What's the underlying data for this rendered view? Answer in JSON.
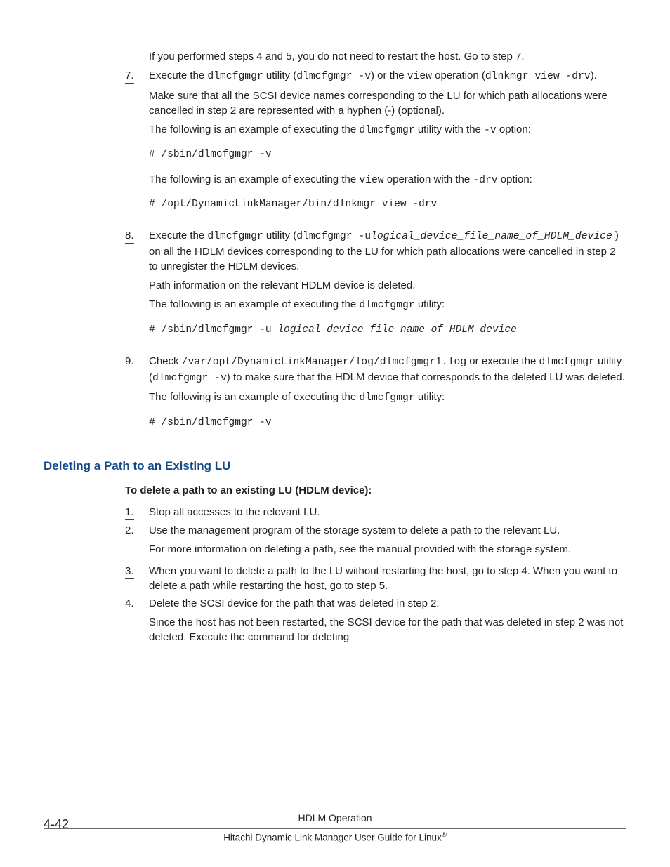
{
  "pre7_a": "If you performed steps 4 and 5, you do not need to restart the host. Go to step 7.",
  "step7_num": "7.",
  "s7_t1": "Execute the ",
  "s7_c1": "dlmcfgmgr",
  "s7_t2": " utility (",
  "s7_c2": "dlmcfgmgr -v",
  "s7_t3": ") or the ",
  "s7_c3": "view",
  "s7_t4": " operation (",
  "s7_c4": "dlnkmgr view -drv",
  "s7_t5": ").",
  "s7_p2": "Make sure that all the SCSI device names corresponding to the LU for which path allocations were cancelled in step 2 are represented with a hyphen (-) (optional).",
  "s7_p3a": "The following is an example of executing the ",
  "s7_p3c": "dlmcfgmgr",
  "s7_p3b": " utility with the ",
  "s7_p3d": "-v",
  "s7_p3e": " option:",
  "s7_cb1": "# /sbin/dlmcfgmgr -v",
  "s7_p4a": "The following is an example of executing the ",
  "s7_p4c": "view",
  "s7_p4b": " operation with the ",
  "s7_p4d": "-drv",
  "s7_p4e": " option:",
  "s7_cb2": "# /opt/DynamicLinkManager/bin/dlnkmgr view -drv",
  "step8_num": "8.",
  "s8_t1": "Execute the ",
  "s8_c1": "dlmcfgmgr",
  "s8_t2": " utility (",
  "s8_c2": "dlmcfgmgr -u",
  "s8_c2b": "logical_device_file_name_of_HDLM_device",
  "s8_t3": " ) on all the HDLM devices corresponding to the LU for which path allocations were cancelled in step 2 to unregister the HDLM devices.",
  "s8_p2": "Path information on the relevant HDLM device is deleted.",
  "s8_p3a": "The following is an example of executing the ",
  "s8_p3c": "dlmcfgmgr",
  "s8_p3b": " utility:",
  "s8_cb1a": "# /sbin/dlmcfgmgr -u ",
  "s8_cb1b": "logical_device_file_name_of_HDLM_device",
  "step9_num": "9.",
  "s9_t1": "Check ",
  "s9_c1": "/var/opt/DynamicLinkManager/log/dlmcfgmgr1.log",
  "s9_t2": " or execute the ",
  "s9_c2": "dlmcfgmgr",
  "s9_t3": " utility (",
  "s9_c3": "dlmcfgmgr -v",
  "s9_t4": ") to make sure that the HDLM device that corresponds to the deleted LU was deleted.",
  "s9_p2a": "The following is an example of executing the ",
  "s9_p2c": "dlmcfgmgr",
  "s9_p2b": " utility:",
  "s9_cb1": "# /sbin/dlmcfgmgr -v",
  "heading": "Deleting a Path to an Existing LU",
  "lead": "To delete a path to an existing LU (HDLM device):",
  "b1_num": "1.",
  "b1": "Stop all accesses to the relevant LU.",
  "b2_num": "2.",
  "b2a": "Use the management program of the storage system to delete a path to the relevant LU.",
  "b2b": "For more information on deleting a path, see the manual provided with the storage system.",
  "b3_num": "3.",
  "b3": "When you want to delete a path to the LU without restarting the host, go to step 4. When you want to delete a path while restarting the host, go to step 5.",
  "b4_num": "4.",
  "b4a": "Delete the SCSI device for the path that was deleted in step 2.",
  "b4b": "Since the host has not been restarted, the SCSI device for the path that was deleted in step 2 was not deleted. Execute the command for deleting",
  "pagenum": "4-42",
  "ftitle": "HDLM Operation",
  "fsub1": "Hitachi Dynamic Link Manager User Guide for Linux",
  "fsub2": "®"
}
